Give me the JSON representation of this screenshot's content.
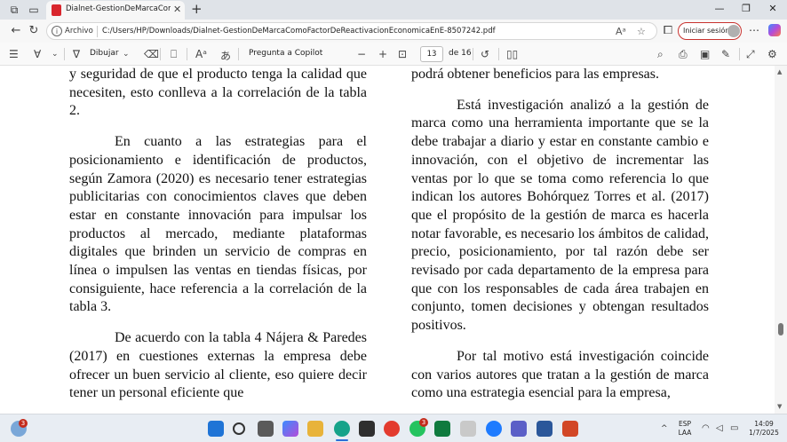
{
  "browser": {
    "tab_title": "Dialnet-GestionDeMarcaComoFac",
    "url_label": "Archivo",
    "url": "C:/Users/HP/Downloads/Dialnet-GestionDeMarcaComoFactorDeReactivacionEconomicaEnE-8507242.pdf",
    "signin_label": "Iniciar sesión"
  },
  "pdf_toolbar": {
    "draw_label": "Dibujar",
    "ask_copilot_label": "Pregunta a Copilot",
    "zoom_out": "−",
    "zoom_in": "+",
    "current_page": "13",
    "page_total": "de 16"
  },
  "document": {
    "left_column": [
      "y seguridad de que el producto tenga la calidad que necesiten, esto conlleva a la correlación de la tabla 2.",
      "En cuanto a las estrategias para el posicionamiento e identificación de productos, según Zamora (2020) es necesario tener estrategias publicitarias con conocimientos claves que deben estar en constante innovación para impulsar los productos al mercado, mediante plataformas digitales que brinden un servicio de compras en línea o impulsen las ventas en tiendas físicas, por consiguiente, hace referencia a la correlación de la tabla 3.",
      "De acuerdo con la tabla 4 Nájera & Paredes (2017) en cuestiones externas la empresa debe ofrecer un buen servicio al cliente, eso quiere decir tener un personal eficiente que"
    ],
    "right_column": [
      "podrá obtener beneficios para las empresas.",
      "Está investigación analizó a la gestión de marca como una herramienta importante que se la debe trabajar a diario y estar en constante cambio e innovación, con el objetivo de incrementar las ventas por lo que se toma como referencia lo que indican los autores Bohórquez Torres et al. (2017) que el propósito de la gestión de marca es hacerla notar favorable, es necesario los ámbitos de calidad, precio, posicionamiento, por tal razón debe ser revisado por cada departamento de la empresa para que con los responsables de cada área trabajen en conjunto, tomen decisiones y obtengan resultados positivos.",
      "Por tal motivo está investigación coincide con varios autores que tratan a la gestión de marca como una estrategia esencial para la empresa,"
    ]
  },
  "taskbar": {
    "weather_badge": "3",
    "whatsapp_badge": "3",
    "language": "ESP",
    "keyboard": "LAA",
    "time": "14:09",
    "date": "1/7/2025"
  }
}
